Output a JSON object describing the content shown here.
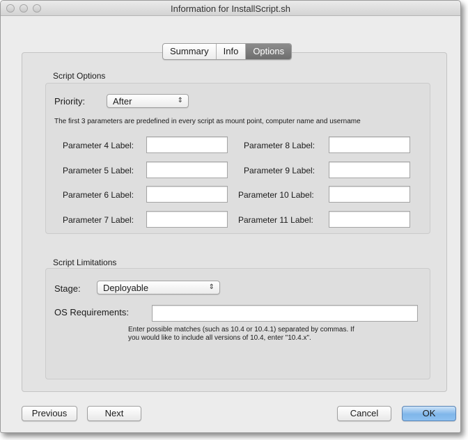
{
  "window": {
    "title": "Information for InstallScript.sh"
  },
  "tabs": [
    {
      "label": "Summary",
      "active": false
    },
    {
      "label": "Info",
      "active": false
    },
    {
      "label": "Options",
      "active": true
    }
  ],
  "script_options": {
    "title": "Script Options",
    "priority_label": "Priority:",
    "priority_value": "After",
    "description": "The first 3 parameters are predefined in every script as mount point, computer name and username",
    "parameters_left": [
      {
        "label": "Parameter 4 Label:",
        "value": ""
      },
      {
        "label": "Parameter 5 Label:",
        "value": ""
      },
      {
        "label": "Parameter 6 Label:",
        "value": ""
      },
      {
        "label": "Parameter 7 Label:",
        "value": ""
      }
    ],
    "parameters_right": [
      {
        "label": "Parameter 8 Label:",
        "value": ""
      },
      {
        "label": "Parameter 9 Label:",
        "value": ""
      },
      {
        "label": "Parameter 10 Label:",
        "value": ""
      },
      {
        "label": "Parameter 11 Label:",
        "value": ""
      }
    ]
  },
  "script_limitations": {
    "title": "Script Limitations",
    "stage_label": "Stage:",
    "stage_value": "Deployable",
    "os_label": "OS Requirements:",
    "os_value": "",
    "hint_line1": "Enter possible matches (such as 10.4 or 10.4.1) separated by commas. If",
    "hint_line2": "you would like to include all versions of 10.4, enter \"10.4.x\"."
  },
  "footer": {
    "previous": "Previous",
    "next": "Next",
    "cancel": "Cancel",
    "ok": "OK"
  },
  "colors": {
    "default_button": "#7fb6ea",
    "selected_tab": "#7a7a7a"
  }
}
